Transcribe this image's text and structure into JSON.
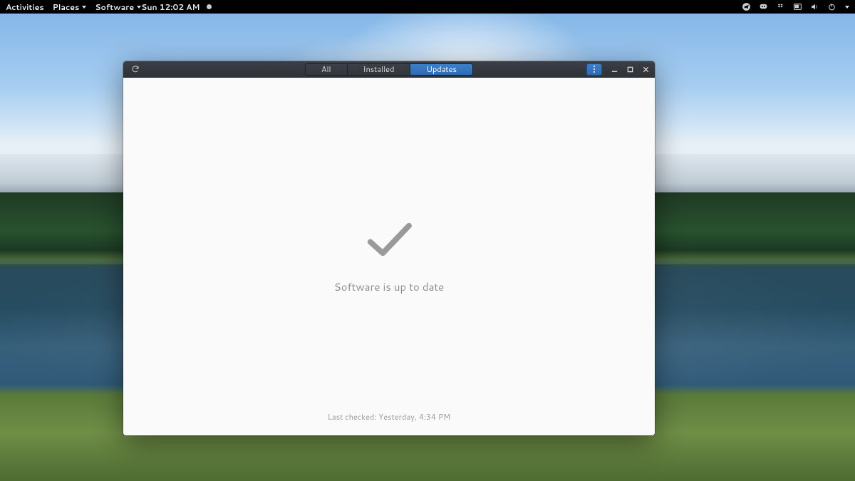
{
  "topbar": {
    "activities": "Activities",
    "places": "Places",
    "software": "Software",
    "clock": "Sun 12:02 AM",
    "tray": {
      "telegram": "telegram-icon",
      "discord": "discord-icon",
      "dropbox": "dropbox-icon",
      "workspaces": "workspaces-icon",
      "volume": "volume-icon",
      "power": "power-icon"
    }
  },
  "window": {
    "tabs": {
      "all": "All",
      "installed": "Installed",
      "updates": "Updates"
    },
    "active_tab": "updates",
    "status": "Software is up to date",
    "last_checked": "Last checked: Yesterday,  4:34 PM"
  }
}
